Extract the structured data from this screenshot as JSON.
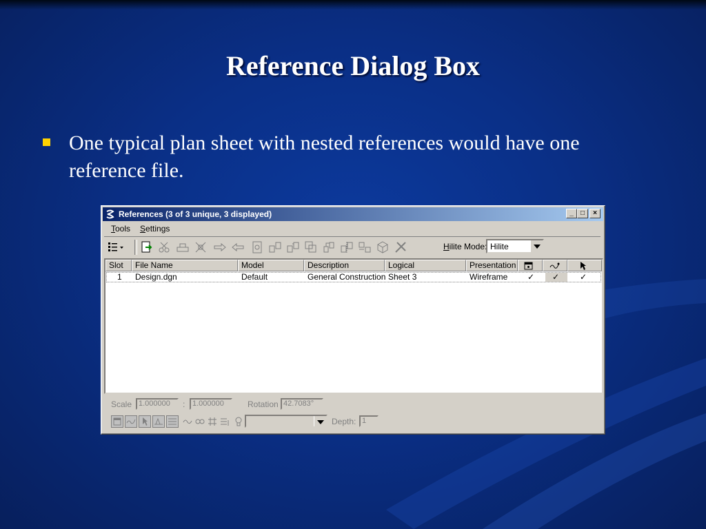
{
  "slide": {
    "title": "Reference Dialog Box",
    "bullet": "One typical plan sheet with nested references would have one reference file."
  },
  "window": {
    "title": "References (3 of 3 unique, 3 displayed)",
    "controls": {
      "minimize": "_",
      "maximize": "□",
      "close": "×"
    }
  },
  "menu": [
    {
      "accel": "T",
      "rest": "ools"
    },
    {
      "accel": "S",
      "rest": "ettings"
    }
  ],
  "toolbar": {
    "hilite_label_accel": "H",
    "hilite_label_rest": "ilite Mode:",
    "hilite_value": "Hilite",
    "icons": [
      "list-view-icon",
      "attach-icon",
      "detach-icon",
      "reload-icon",
      "clip-boundary-icon",
      "clip-mask-icon",
      "clip-front-icon",
      "clip-back-icon",
      "rotate-icon",
      "move-icon",
      "copy-icon",
      "scale-icon",
      "mirror-horizontal-icon",
      "mirror-vertical-icon",
      "exchange-icon",
      "merge-icon",
      "3d-view-icon",
      "settings-close-icon"
    ]
  },
  "table": {
    "headers": [
      "Slot",
      "File Name",
      "Model",
      "Description",
      "Logical",
      "Presentation"
    ],
    "rows": [
      {
        "slot": "1",
        "file": "Design.dgn",
        "model": "Default",
        "description": "General Construction",
        "logical": "Sheet 3",
        "presentation": "Wireframe",
        "display": "✓",
        "snap": "✓",
        "locate": "✓"
      }
    ]
  },
  "bottom": {
    "scale_label": "Scale",
    "scale_a": "1.000000",
    "scale_sep": ":",
    "scale_b": "1.000000",
    "rotation_label": "Rotation",
    "rotation_value": "42.7083°",
    "depth_label": "Depth:",
    "depth_value": "1"
  },
  "colors": {
    "background": "#0a2f86",
    "bullet": "#ffd200",
    "titlebar_start": "#0a246a",
    "titlebar_end": "#a6caf0",
    "dialog_face": "#d4d0c8"
  }
}
